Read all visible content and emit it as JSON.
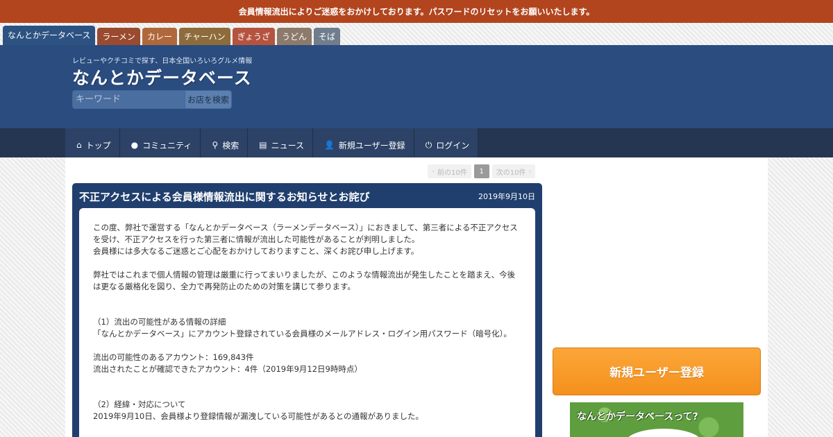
{
  "alert": "会員情報流出によりご迷惑をおかけしております。パスワードのリセットをお願いいたします。",
  "site_tabs": [
    {
      "label": "なんとかデータベース",
      "color": "#2c5282"
    },
    {
      "label": "ラーメン",
      "color": "#9a4a2e"
    },
    {
      "label": "カレー",
      "color": "#b0683a"
    },
    {
      "label": "チャーハン",
      "color": "#8e6b3b"
    },
    {
      "label": "ぎょうざ",
      "color": "#b5533f"
    },
    {
      "label": "うどん",
      "color": "#8c7a6b"
    },
    {
      "label": "そば",
      "color": "#6f7d8c"
    }
  ],
  "header": {
    "tagline": "レビューやクチコミで探す、日本全国いろいろグルメ情報",
    "logo": "なんとかデータベース"
  },
  "search": {
    "placeholder": "キーワード",
    "button": "お店を検索"
  },
  "nav": [
    {
      "label": "トップ",
      "icon": "home-icon",
      "glyph": "⌂"
    },
    {
      "label": "コミュニティ",
      "icon": "chat-icon",
      "glyph": "●"
    },
    {
      "label": "検索",
      "icon": "search-icon",
      "glyph": "⚲"
    },
    {
      "label": "ニュース",
      "icon": "news-icon",
      "glyph": "▤"
    },
    {
      "label": "新規ユーザー登録",
      "icon": "add-user-icon",
      "glyph": "👤"
    },
    {
      "label": "ログイン",
      "icon": "power-icon",
      "glyph": "⏻"
    }
  ],
  "pager": {
    "prev": "前の10件",
    "current": "1",
    "next": "次の10件"
  },
  "article": {
    "title": "不正アクセスによる会員様情報流出に関するお知らせとお詫び",
    "date": "2019年9月10日",
    "p1": "この度、弊社で運営する「なんとかデータベース（ラーメンデータベース）」におきまして、第三者による不正アクセスを受け、不正アクセスを行った第三者に情報が流出した可能性があることが判明しました。",
    "p1b": "会員様には多大なるご迷惑とご心配をおかけしておりますこと、深くお詫び申し上げます。",
    "p2": "弊社ではこれまで個人情報の管理は厳重に行ってまいりましたが、このような情報流出が発生したことを踏まえ、今後は更なる厳格化を図り、全力で再発防止のための対策を講じて参ります。",
    "s1_head": "（1）流出の可能性がある情報の詳細",
    "s1_body": "「なんとかデータベース」にアカウント登録されている会員様のメールアドレス・ログイン用パスワード（暗号化）。",
    "s1_count1": "流出の可能性のあるアカウント：169,843件",
    "s1_count2": "流出されたことが確認できたアカウント：4件（2019年9月12日9時時点）",
    "s2_head": "（2）経緯・対応について",
    "s2_body": "2019年9月10日、会員様より登録情報が漏洩している可能性があるとの通報がありました。"
  },
  "sidebar": {
    "register_button": "新規ユーザー登録",
    "promo_text": "なんとかデータベースって?"
  }
}
